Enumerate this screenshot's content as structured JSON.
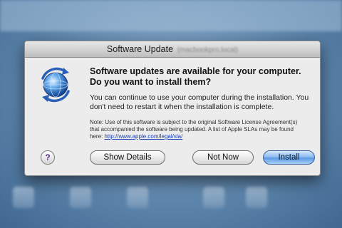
{
  "dialog": {
    "title": "Software Update",
    "title_sub": "(macbookpro.local)",
    "headline": "Software updates are available for your computer. Do you want to install them?",
    "body": "You can continue to use your computer during the installation. You don't need to restart it when the installation is complete.",
    "note": "Note: Use of this software is subject to the original Software License Agreement(s) that accompanied the software being updated. A list of Apple SLAs may be found here:",
    "note_link": "http://www.apple.com/legal/sla/",
    "help_label": "?",
    "buttons": {
      "details": "Show Details",
      "not_now": "Not Now",
      "install": "Install"
    }
  },
  "icons": {
    "app": "software-update-globe-icon",
    "help": "help-icon"
  },
  "colors": {
    "dialog_bg": "#ececec",
    "install_button": "#5d9ae4",
    "link": "#1a3fb5",
    "desktop": "#5f87ad"
  }
}
